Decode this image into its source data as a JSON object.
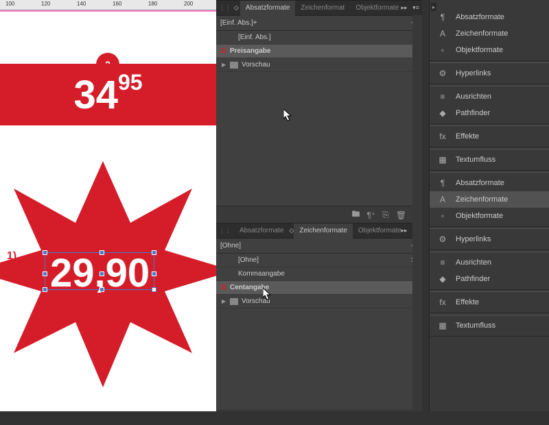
{
  "ruler": [
    "100",
    "120",
    "140",
    "160",
    "180",
    "200"
  ],
  "canvas": {
    "circle": "2",
    "price1_main": "34",
    "price1_sup": "95",
    "annotation1": "1)",
    "price2": "29,90"
  },
  "panel_top": {
    "tabs": [
      "Absatzformate",
      "Zeichenformat",
      "Objektformate"
    ],
    "header": "[Einf. Abs.]+",
    "rows": [
      {
        "label": "[Einf. Abs.]",
        "indent": 1
      },
      {
        "label": "Preisangabe",
        "sel": true,
        "mark": "2)"
      },
      {
        "label": "Vorschau",
        "folder": true,
        "arrow": true
      }
    ]
  },
  "panel_bottom": {
    "tabs": [
      "Absatzformate",
      "Zeichenformate",
      "Objektformate"
    ],
    "header": "[Ohne]",
    "rows": [
      {
        "label": "[Ohne]",
        "closex": true
      },
      {
        "label": "Kommaangabe"
      },
      {
        "label": "Centangabe",
        "sel": true,
        "mark": "3)"
      },
      {
        "label": "Vorschau",
        "folder": true,
        "arrow": true
      }
    ]
  },
  "dock": [
    {
      "group": [
        {
          "icon": "¶",
          "label": "Absatzformate"
        },
        {
          "icon": "A",
          "label": "Zeichenformate"
        },
        {
          "icon": "▫",
          "label": "Objektformate"
        }
      ]
    },
    {
      "group": [
        {
          "icon": "⚙",
          "label": "Hyperlinks"
        }
      ]
    },
    {
      "group": [
        {
          "icon": "≡",
          "label": "Ausrichten"
        },
        {
          "icon": "◆",
          "label": "Pathfinder"
        }
      ]
    },
    {
      "group": [
        {
          "icon": "fx",
          "label": "Effekte"
        }
      ]
    },
    {
      "group": [
        {
          "icon": "▦",
          "label": "Textumfluss"
        }
      ]
    },
    {
      "group": [
        {
          "icon": "¶",
          "label": "Absatzformate"
        },
        {
          "icon": "A",
          "label": "Zeichenformate",
          "sel": true
        },
        {
          "icon": "▫",
          "label": "Objektformate"
        }
      ]
    },
    {
      "group": [
        {
          "icon": "⚙",
          "label": "Hyperlinks"
        }
      ]
    },
    {
      "group": [
        {
          "icon": "≡",
          "label": "Ausrichten"
        },
        {
          "icon": "◆",
          "label": "Pathfinder"
        }
      ]
    },
    {
      "group": [
        {
          "icon": "fx",
          "label": "Effekte"
        }
      ]
    },
    {
      "group": [
        {
          "icon": "▦",
          "label": "Textumfluss"
        }
      ]
    }
  ]
}
